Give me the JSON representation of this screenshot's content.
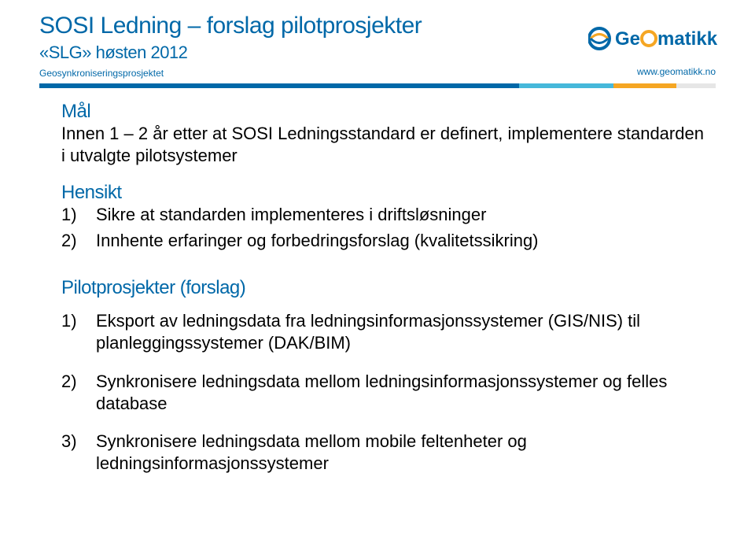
{
  "header": {
    "title": "SOSI Ledning – forslag pilotprosjekter",
    "subtitle": "«SLG» høsten 2012",
    "meta_left": "Geosynkroniseringsprosjektet",
    "meta_right": "www.geomatikk.no",
    "logo_text": "Geomatikk"
  },
  "sections": {
    "maal": {
      "heading": "Mål",
      "text": "Innen 1 – 2 år etter at SOSI Ledningsstandard er definert, implementere standarden i utvalgte pilotsystemer"
    },
    "hensikt": {
      "heading": "Hensikt",
      "items": [
        {
          "n": "1)",
          "text": "Sikre at standarden implementeres i driftsløsninger"
        },
        {
          "n": "2)",
          "text": "Innhente erfaringer og forbedringsforslag (kvalitetssikring)"
        }
      ]
    },
    "pilot": {
      "heading": "Pilotprosjekter (forslag)",
      "items": [
        {
          "n": "1)",
          "text": "Eksport av  ledningsdata fra ledningsinformasjonssystemer (GIS/NIS) til  planleggingssystemer (DAK/BIM)"
        },
        {
          "n": "2)",
          "text": "Synkronisere ledningsdata mellom ledningsinformasjonssystemer og felles database"
        },
        {
          "n": "3)",
          "text": "Synkronisere ledningsdata mellom mobile feltenheter og ledningsinformasjonssystemer"
        }
      ]
    }
  }
}
